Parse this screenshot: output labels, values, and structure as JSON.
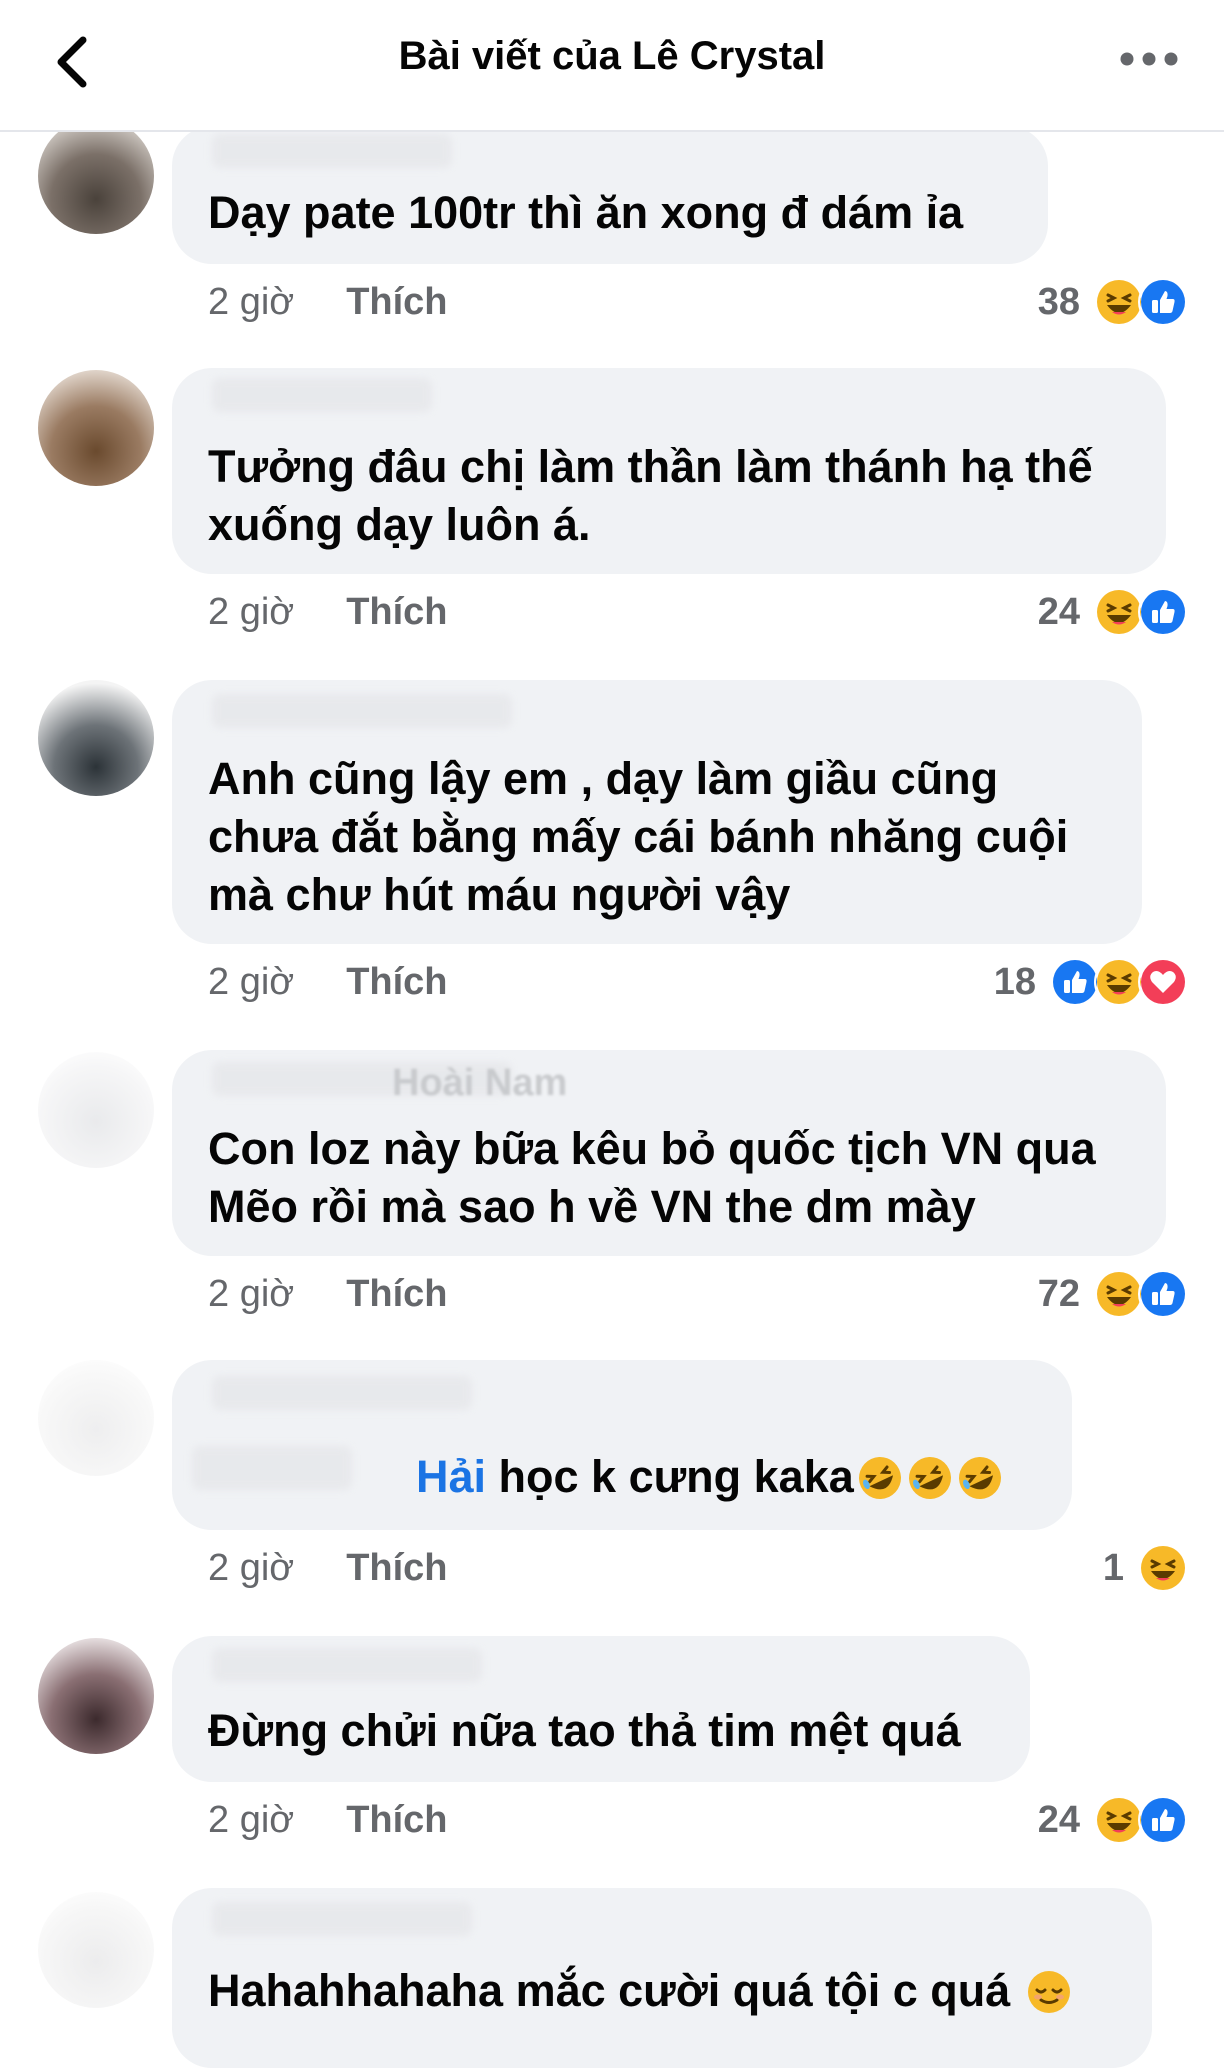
{
  "header": {
    "title": "Bài viết của Lê Crystal",
    "back_icon": "chevron-left-icon",
    "more_icon": "more-horizontal-icon"
  },
  "colors": {
    "bubble": "#f0f2f5",
    "secondary_text": "#65676b",
    "like_blue": "#1877f2",
    "haha_yellow": "#f7b928",
    "love_red": "#f33e58"
  },
  "comments": [
    {
      "text": "Dạy pate 100tr thì ăn xong đ dám ỉa",
      "time": "2 giờ",
      "like_label": "Thích",
      "reaction_count": "38",
      "reactions": [
        "haha-icon",
        "like-icon"
      ]
    },
    {
      "text": "Tưởng đâu chị làm thần làm thánh hạ thế\nxuống dạy luôn á.",
      "time": "2 giờ",
      "like_label": "Thích",
      "reaction_count": "24",
      "reactions": [
        "haha-icon",
        "like-icon"
      ]
    },
    {
      "text": "Anh cũng lậy em , dạy làm giầu cũng\nchưa đắt bằng mấy cái bánh nhăng cuội\nmà chư hút máu người vậy",
      "time": "2 giờ",
      "like_label": "Thích",
      "reaction_count": "18",
      "reactions": [
        "like-icon",
        "haha-icon",
        "love-icon"
      ]
    },
    {
      "name_fragment": "Hoài Nam",
      "text": "Con loz này bữa kêu bỏ quốc tịch VN qua\nMẽo rồi mà sao h về VN the dm mày",
      "time": "2 giờ",
      "like_label": "Thích",
      "reaction_count": "72",
      "reactions": [
        "haha-icon",
        "like-icon"
      ]
    },
    {
      "mention": "Hải",
      "text": " học k cưng kaka",
      "emojis": [
        "rofl-emoji",
        "rofl-emoji",
        "rofl-emoji"
      ],
      "time": "2 giờ",
      "like_label": "Thích",
      "reaction_count": "1",
      "reactions": [
        "haha-icon"
      ]
    },
    {
      "text": "Đừng chửi nữa tao thả tim mệt quá",
      "time": "2 giờ",
      "like_label": "Thích",
      "reaction_count": "24",
      "reactions": [
        "haha-icon",
        "like-icon"
      ]
    },
    {
      "text": "Hahahhahaha mắc cười quá tội c quá",
      "emojis": [
        "relieved-emoji"
      ]
    }
  ]
}
